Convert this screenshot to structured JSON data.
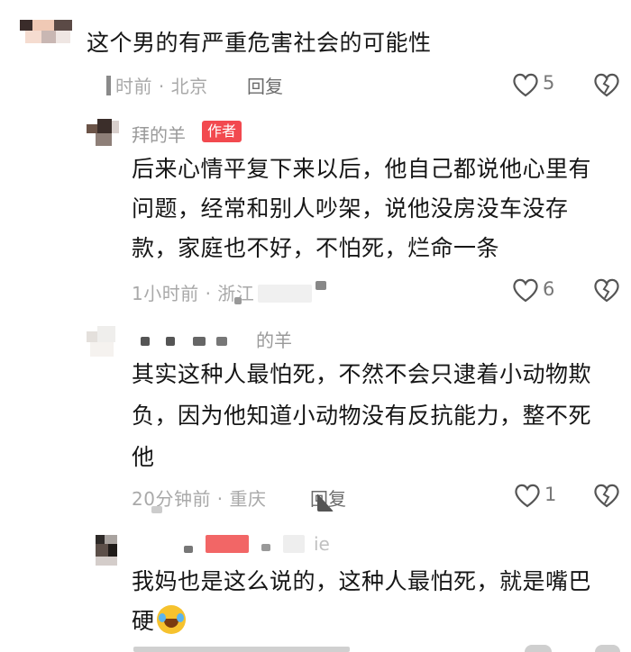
{
  "comments": [
    {
      "text": "这个男的有严重危害社会的可能性",
      "meta": "时前 · 北京",
      "reply": "回复",
      "likes": "5"
    },
    {
      "username": "拜的羊",
      "badge": "作者",
      "line1": "后来心情平复下来以后，他自己都说他心里有",
      "line2": "问题，经常和别人吵架，说他没房没车没存",
      "line3": "款，家庭也不好，不怕死，烂命一条",
      "meta": "1小时前 · 浙江",
      "likes": "6"
    },
    {
      "username": "的羊",
      "line1": "其实这种人最怕死，不然不会只逮着小动物欺",
      "line2": "负，因为他知道小动物没有反抗能力，整不死",
      "line3": "他",
      "meta": "20分钟前 · 重庆",
      "reply": "回复",
      "likes": "1"
    },
    {
      "username": "ie",
      "line1": "我妈也是这么说的，这种人最怕死，就是嘴巴",
      "line2": "硬"
    }
  ]
}
